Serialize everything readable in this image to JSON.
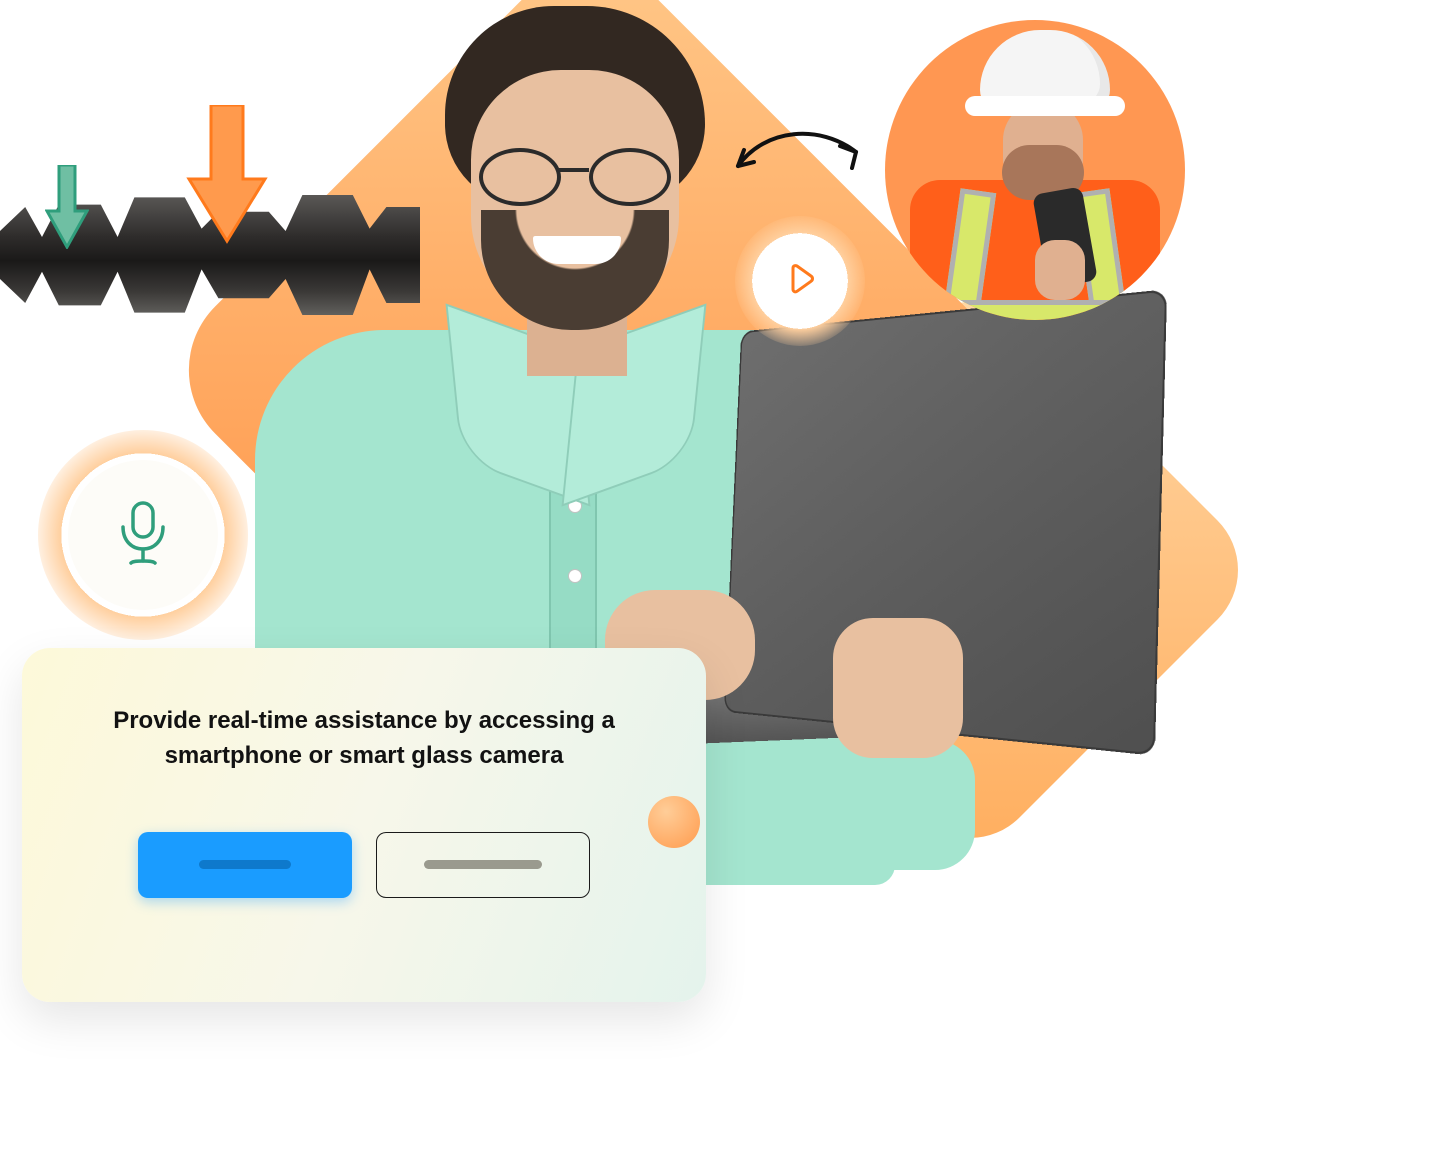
{
  "card": {
    "headline": "Provide real-time assistance by accessing a smartphone or smart glass camera"
  },
  "icons": {
    "play": "play-icon",
    "mic": "microphone-icon",
    "bidirectional": "bidirectional-arrow-icon",
    "arrow_down_green": "arrow-down-green-icon",
    "arrow_down_orange": "arrow-down-orange-icon"
  },
  "colors": {
    "accent_orange": "#ff8a3a",
    "accent_teal": "#2f9e7c",
    "cta_blue": "#1a9cff"
  }
}
